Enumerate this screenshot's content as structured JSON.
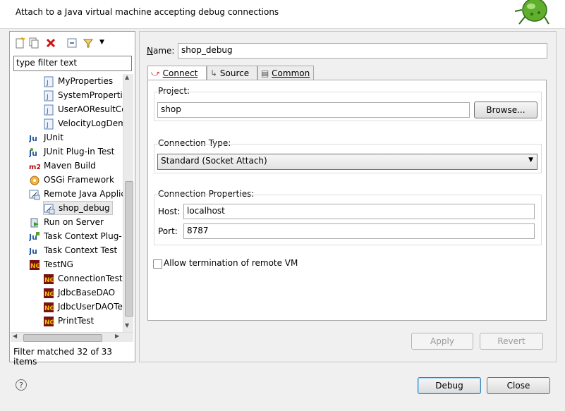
{
  "header": {
    "message": "Attach to a Java virtual machine accepting debug connections"
  },
  "left": {
    "filter_text": "type filter text",
    "tree": [
      {
        "label": "MyProperties",
        "icon": "java-class-icon",
        "level": 2
      },
      {
        "label": "SystemPropertie",
        "icon": "java-class-icon",
        "level": 2
      },
      {
        "label": "UserAOResultCo",
        "icon": "java-class-icon",
        "level": 2
      },
      {
        "label": "VelocityLogDem",
        "icon": "java-class-icon",
        "level": 2
      },
      {
        "label": "JUnit",
        "icon": "junit-icon",
        "level": 1
      },
      {
        "label": "JUnit Plug-in Test",
        "icon": "junit-plugin-icon",
        "level": 1
      },
      {
        "label": "Maven Build",
        "icon": "maven-icon",
        "level": 1
      },
      {
        "label": "OSGi Framework",
        "icon": "osgi-icon",
        "level": 1
      },
      {
        "label": "Remote Java Applic",
        "icon": "remote-java-icon",
        "level": 1
      },
      {
        "label": "shop_debug",
        "icon": "remote-java-icon",
        "level": 2,
        "selected": true
      },
      {
        "label": "Run on Server",
        "icon": "server-icon",
        "level": 1
      },
      {
        "label": "Task Context Plug-",
        "icon": "task-plugin-icon",
        "level": 1
      },
      {
        "label": "Task Context Test",
        "icon": "task-test-icon",
        "level": 1
      },
      {
        "label": "TestNG",
        "icon": "testng-icon",
        "level": 1
      },
      {
        "label": "ConnectionTest",
        "icon": "testng-icon",
        "level": 2
      },
      {
        "label": "JdbcBaseDAO",
        "icon": "testng-icon",
        "level": 2
      },
      {
        "label": "JdbcUserDAOTe",
        "icon": "testng-icon",
        "level": 2
      },
      {
        "label": "PrintTest",
        "icon": "testng-icon",
        "level": 2
      }
    ],
    "status": "Filter matched 32 of 33 items"
  },
  "right": {
    "name_label_u": "N",
    "name_label_rest": "ame:",
    "name_value": "shop_debug",
    "tabs": {
      "connect": "Connect",
      "source": "Source",
      "common": "Common"
    },
    "project_label": "Project:",
    "project_value": "shop",
    "browse_label": "Browse...",
    "connection_type_label": "Connection Type:",
    "connection_type_value": "Standard (Socket Attach)",
    "connection_props_label": "Connection Properties:",
    "host_label": "Host:",
    "host_value": "localhost",
    "port_label": "Port:",
    "port_value": "8787",
    "allow_termination_label": "Allow termination of remote VM",
    "apply_label": "Apply",
    "revert_label": "Revert"
  },
  "footer": {
    "debug_label": "Debug",
    "close_label": "Close"
  },
  "colors": {
    "accent": "#3c7fb1",
    "disabled_text": "#9a9a9a"
  }
}
